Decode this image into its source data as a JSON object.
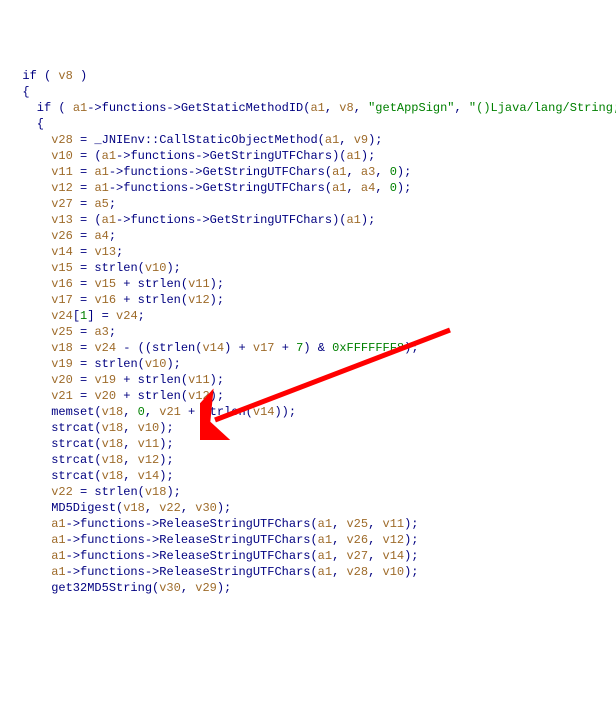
{
  "code": {
    "lines": [
      [
        [
          "kw",
          "  if ( "
        ],
        [
          "var",
          "v8"
        ],
        [
          "kw",
          " )"
        ]
      ],
      [
        [
          "kw",
          "  {"
        ]
      ],
      [
        [
          "kw",
          "    if ( "
        ],
        [
          "var",
          "a1"
        ],
        [
          "kw",
          "->functions->GetStaticMethodID("
        ],
        [
          "var",
          "a1"
        ],
        [
          "kw",
          ", "
        ],
        [
          "var",
          "v8"
        ],
        [
          "kw",
          ", "
        ],
        [
          "str",
          "\"getAppSign\""
        ],
        [
          "kw",
          ", "
        ],
        [
          "str",
          "\"()Ljava/lang/String;\""
        ],
        [
          "kw",
          ") )"
        ]
      ],
      [
        [
          "kw",
          "    {"
        ]
      ],
      [
        [
          "kw",
          "      "
        ],
        [
          "var",
          "v28"
        ],
        [
          "kw",
          " = _JNIEnv::CallStaticObjectMethod("
        ],
        [
          "var",
          "a1"
        ],
        [
          "kw",
          ", "
        ],
        [
          "var",
          "v9"
        ],
        [
          "kw",
          ");"
        ]
      ],
      [
        [
          "kw",
          "      "
        ],
        [
          "var",
          "v10"
        ],
        [
          "kw",
          " = ("
        ],
        [
          "var",
          "a1"
        ],
        [
          "kw",
          "->functions->GetStringUTFChars)("
        ],
        [
          "var",
          "a1"
        ],
        [
          "kw",
          ");"
        ]
      ],
      [
        [
          "kw",
          "      "
        ],
        [
          "var",
          "v11"
        ],
        [
          "kw",
          " = "
        ],
        [
          "var",
          "a1"
        ],
        [
          "kw",
          "->functions->GetStringUTFChars("
        ],
        [
          "var",
          "a1"
        ],
        [
          "kw",
          ", "
        ],
        [
          "var",
          "a3"
        ],
        [
          "kw",
          ", "
        ],
        [
          "num",
          "0"
        ],
        [
          "kw",
          ");"
        ]
      ],
      [
        [
          "kw",
          "      "
        ],
        [
          "var",
          "v12"
        ],
        [
          "kw",
          " = "
        ],
        [
          "var",
          "a1"
        ],
        [
          "kw",
          "->functions->GetStringUTFChars("
        ],
        [
          "var",
          "a1"
        ],
        [
          "kw",
          ", "
        ],
        [
          "var",
          "a4"
        ],
        [
          "kw",
          ", "
        ],
        [
          "num",
          "0"
        ],
        [
          "kw",
          ");"
        ]
      ],
      [
        [
          "kw",
          "      "
        ],
        [
          "var",
          "v27"
        ],
        [
          "kw",
          " = "
        ],
        [
          "var",
          "a5"
        ],
        [
          "kw",
          ";"
        ]
      ],
      [
        [
          "kw",
          "      "
        ],
        [
          "var",
          "v13"
        ],
        [
          "kw",
          " = ("
        ],
        [
          "var",
          "a1"
        ],
        [
          "kw",
          "->functions->GetStringUTFChars)("
        ],
        [
          "var",
          "a1"
        ],
        [
          "kw",
          ");"
        ]
      ],
      [
        [
          "kw",
          "      "
        ],
        [
          "var",
          "v26"
        ],
        [
          "kw",
          " = "
        ],
        [
          "var",
          "a4"
        ],
        [
          "kw",
          ";"
        ]
      ],
      [
        [
          "kw",
          "      "
        ],
        [
          "var",
          "v14"
        ],
        [
          "kw",
          " = "
        ],
        [
          "var",
          "v13"
        ],
        [
          "kw",
          ";"
        ]
      ],
      [
        [
          "kw",
          "      "
        ],
        [
          "var",
          "v15"
        ],
        [
          "kw",
          " = strlen("
        ],
        [
          "var",
          "v10"
        ],
        [
          "kw",
          ");"
        ]
      ],
      [
        [
          "kw",
          "      "
        ],
        [
          "var",
          "v16"
        ],
        [
          "kw",
          " = "
        ],
        [
          "var",
          "v15"
        ],
        [
          "kw",
          " + strlen("
        ],
        [
          "var",
          "v11"
        ],
        [
          "kw",
          ");"
        ]
      ],
      [
        [
          "kw",
          "      "
        ],
        [
          "var",
          "v17"
        ],
        [
          "kw",
          " = "
        ],
        [
          "var",
          "v16"
        ],
        [
          "kw",
          " + strlen("
        ],
        [
          "var",
          "v12"
        ],
        [
          "kw",
          ");"
        ]
      ],
      [
        [
          "kw",
          "      "
        ],
        [
          "var",
          "v24"
        ],
        [
          "kw",
          "["
        ],
        [
          "num",
          "1"
        ],
        [
          "kw",
          "] = "
        ],
        [
          "var",
          "v24"
        ],
        [
          "kw",
          ";"
        ]
      ],
      [
        [
          "kw",
          "      "
        ],
        [
          "var",
          "v25"
        ],
        [
          "kw",
          " = "
        ],
        [
          "var",
          "a3"
        ],
        [
          "kw",
          ";"
        ]
      ],
      [
        [
          "kw",
          "      "
        ],
        [
          "var",
          "v18"
        ],
        [
          "kw",
          " = "
        ],
        [
          "var",
          "v24"
        ],
        [
          "kw",
          " - ((strlen("
        ],
        [
          "var",
          "v14"
        ],
        [
          "kw",
          ") + "
        ],
        [
          "var",
          "v17"
        ],
        [
          "kw",
          " + "
        ],
        [
          "num",
          "7"
        ],
        [
          "kw",
          ") & "
        ],
        [
          "num",
          "0xFFFFFFF8"
        ],
        [
          "kw",
          ");"
        ]
      ],
      [
        [
          "kw",
          "      "
        ],
        [
          "var",
          "v19"
        ],
        [
          "kw",
          " = strlen("
        ],
        [
          "var",
          "v10"
        ],
        [
          "kw",
          ");"
        ]
      ],
      [
        [
          "kw",
          "      "
        ],
        [
          "var",
          "v20"
        ],
        [
          "kw",
          " = "
        ],
        [
          "var",
          "v19"
        ],
        [
          "kw",
          " + strlen("
        ],
        [
          "var",
          "v11"
        ],
        [
          "kw",
          ");"
        ]
      ],
      [
        [
          "kw",
          "      "
        ],
        [
          "var",
          "v21"
        ],
        [
          "kw",
          " = "
        ],
        [
          "var",
          "v20"
        ],
        [
          "kw",
          " + strlen("
        ],
        [
          "var",
          "v12"
        ],
        [
          "kw",
          ");"
        ]
      ],
      [
        [
          "kw",
          "      memset("
        ],
        [
          "var",
          "v18"
        ],
        [
          "kw",
          ", "
        ],
        [
          "num",
          "0"
        ],
        [
          "kw",
          ", "
        ],
        [
          "var",
          "v21"
        ],
        [
          "kw",
          " + strlen("
        ],
        [
          "var",
          "v14"
        ],
        [
          "kw",
          "));"
        ]
      ],
      [
        [
          "kw",
          "      strcat("
        ],
        [
          "var",
          "v18"
        ],
        [
          "kw",
          ", "
        ],
        [
          "var",
          "v10"
        ],
        [
          "kw",
          ");"
        ]
      ],
      [
        [
          "kw",
          "      strcat("
        ],
        [
          "var",
          "v18"
        ],
        [
          "kw",
          ", "
        ],
        [
          "var",
          "v11"
        ],
        [
          "kw",
          ");"
        ]
      ],
      [
        [
          "kw",
          "      strcat("
        ],
        [
          "var",
          "v18"
        ],
        [
          "kw",
          ", "
        ],
        [
          "var",
          "v12"
        ],
        [
          "kw",
          ");"
        ]
      ],
      [
        [
          "kw",
          "      strcat("
        ],
        [
          "var",
          "v18"
        ],
        [
          "kw",
          ", "
        ],
        [
          "var",
          "v14"
        ],
        [
          "kw",
          ");"
        ]
      ],
      [
        [
          "kw",
          "      "
        ],
        [
          "var",
          "v22"
        ],
        [
          "kw",
          " = strlen("
        ],
        [
          "var",
          "v18"
        ],
        [
          "kw",
          ");"
        ]
      ],
      [
        [
          "kw",
          "      MD5Digest("
        ],
        [
          "var",
          "v18"
        ],
        [
          "kw",
          ", "
        ],
        [
          "var",
          "v22"
        ],
        [
          "kw",
          ", "
        ],
        [
          "var",
          "v30"
        ],
        [
          "kw",
          ");"
        ]
      ],
      [
        [
          "kw",
          "      "
        ],
        [
          "var",
          "a1"
        ],
        [
          "kw",
          "->functions->ReleaseStringUTFChars("
        ],
        [
          "var",
          "a1"
        ],
        [
          "kw",
          ", "
        ],
        [
          "var",
          "v25"
        ],
        [
          "kw",
          ", "
        ],
        [
          "var",
          "v11"
        ],
        [
          "kw",
          ");"
        ]
      ],
      [
        [
          "kw",
          "      "
        ],
        [
          "var",
          "a1"
        ],
        [
          "kw",
          "->functions->ReleaseStringUTFChars("
        ],
        [
          "var",
          "a1"
        ],
        [
          "kw",
          ", "
        ],
        [
          "var",
          "v26"
        ],
        [
          "kw",
          ", "
        ],
        [
          "var",
          "v12"
        ],
        [
          "kw",
          ");"
        ]
      ],
      [
        [
          "kw",
          "      "
        ],
        [
          "var",
          "a1"
        ],
        [
          "kw",
          "->functions->ReleaseStringUTFChars("
        ],
        [
          "var",
          "a1"
        ],
        [
          "kw",
          ", "
        ],
        [
          "var",
          "v27"
        ],
        [
          "kw",
          ", "
        ],
        [
          "var",
          "v14"
        ],
        [
          "kw",
          ");"
        ]
      ],
      [
        [
          "kw",
          "      "
        ],
        [
          "var",
          "a1"
        ],
        [
          "kw",
          "->functions->ReleaseStringUTFChars("
        ],
        [
          "var",
          "a1"
        ],
        [
          "kw",
          ", "
        ],
        [
          "var",
          "v28"
        ],
        [
          "kw",
          ", "
        ],
        [
          "var",
          "v10"
        ],
        [
          "kw",
          ");"
        ]
      ],
      [
        [
          "kw",
          "      get32MD5String("
        ],
        [
          "var",
          "v30"
        ],
        [
          "kw",
          ", "
        ],
        [
          "var",
          "v29"
        ],
        [
          "kw",
          ");"
        ]
      ]
    ]
  },
  "annotation": {
    "arrow_target_line": 26
  }
}
